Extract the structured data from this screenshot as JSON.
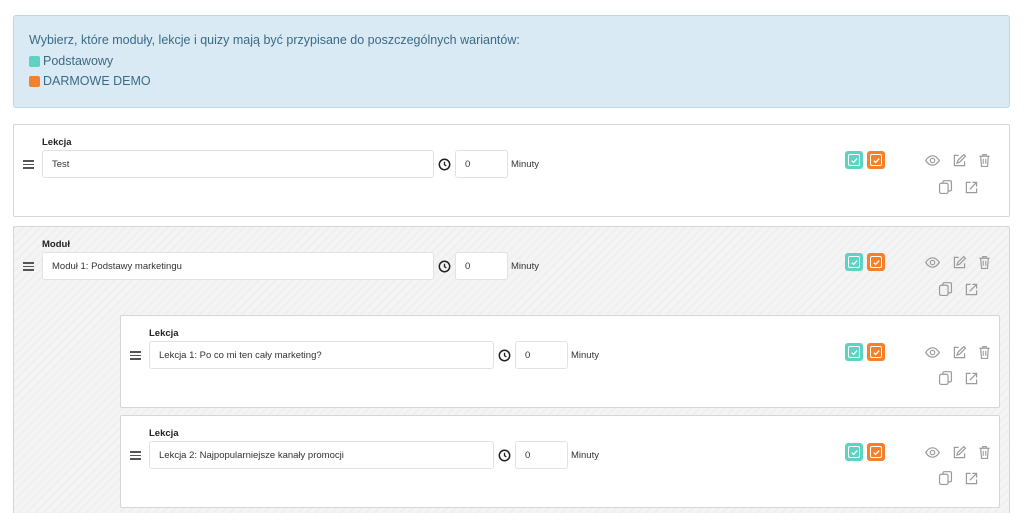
{
  "info": {
    "text": "Wybierz, które moduły, lekcje i quizy mają być przypisane do poszczególnych wariantów:",
    "variants": [
      {
        "label": "Podstawowy",
        "color": "#5fd3c3"
      },
      {
        "label": "DARMOWE DEMO",
        "color": "#f5802c"
      }
    ]
  },
  "items": [
    {
      "type_label": "Lekcja",
      "name": "Test",
      "duration": "0",
      "unit": "Minuty",
      "variant_podstawowy": true,
      "variant_demo": true
    },
    {
      "type_label": "Moduł",
      "name": "Moduł 1: Podstawy marketingu",
      "duration": "0",
      "unit": "Minuty",
      "variant_podstawowy": true,
      "variant_demo": true
    },
    {
      "type_label": "Lekcja",
      "name": "Lekcja 1: Po co mi ten cały marketing?",
      "duration": "0",
      "unit": "Minuty",
      "variant_podstawowy": true,
      "variant_demo": true
    },
    {
      "type_label": "Lekcja",
      "name": "Lekcja 2: Najpopularniejsze kanały promocji",
      "duration": "0",
      "unit": "Minuty",
      "variant_podstawowy": true,
      "variant_demo": true
    }
  ],
  "icons": {
    "drag": "drag-handle-icon",
    "clock": "clock-icon",
    "preview": "eye-icon",
    "edit": "edit-icon",
    "delete": "trash-icon",
    "duplicate": "copy-icon",
    "move": "move-icon"
  },
  "colors": {
    "info_bg": "#d9eaf4",
    "teal": "#5fd3c3",
    "orange": "#f5802c",
    "icon_gray": "#9a9a9a"
  }
}
